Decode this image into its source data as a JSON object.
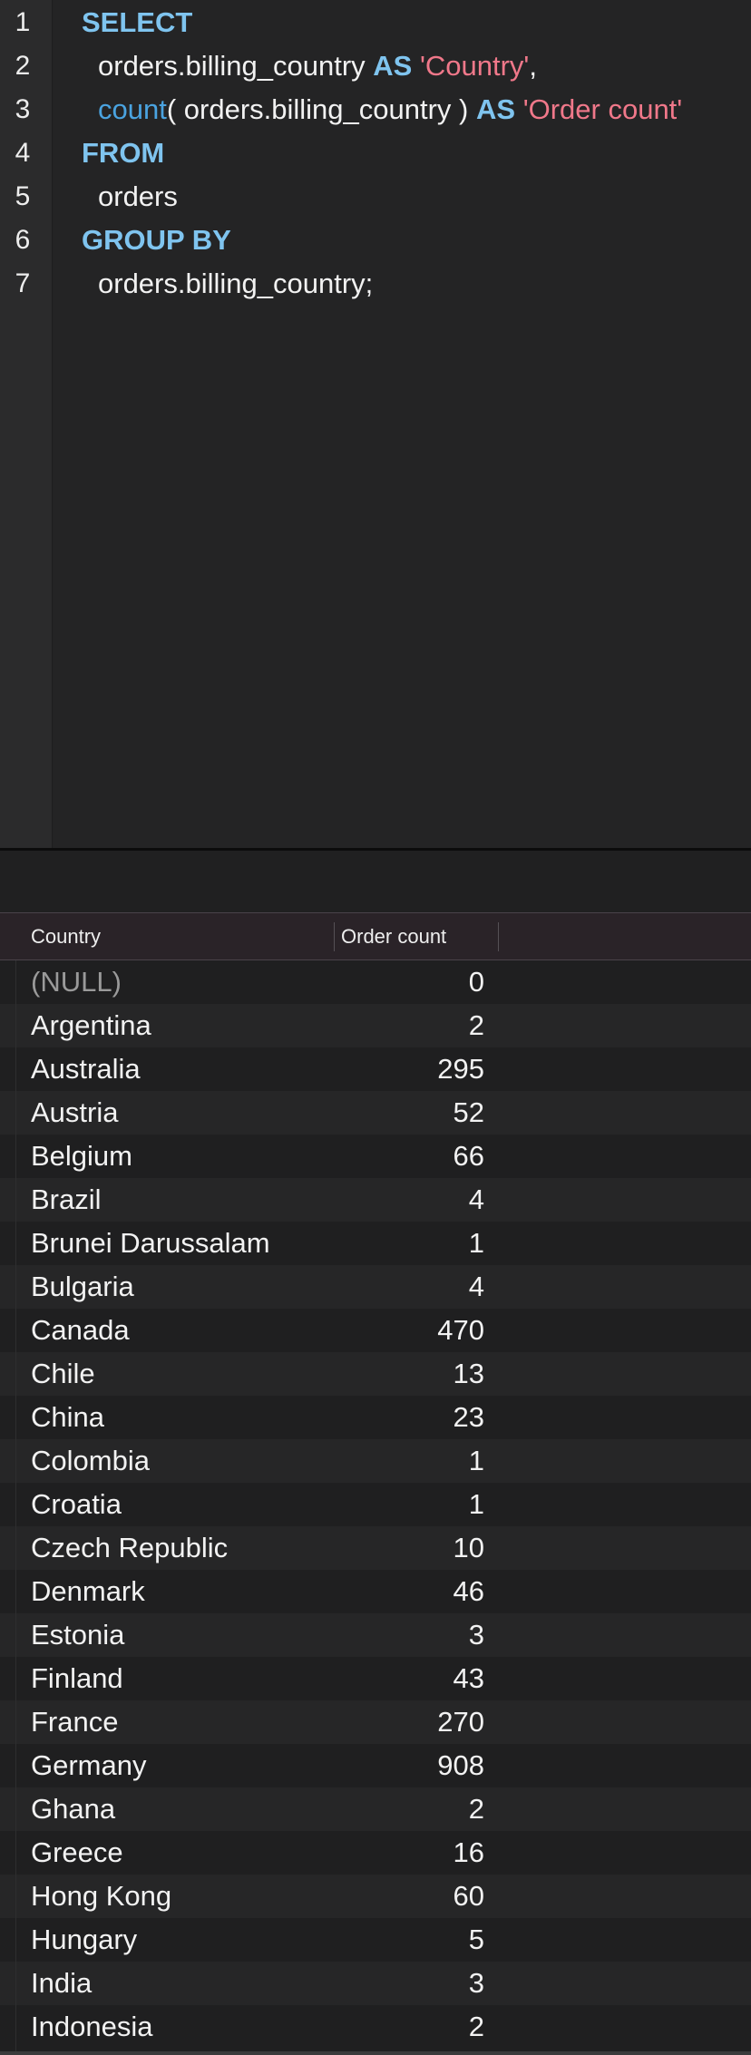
{
  "editor": {
    "lines": [
      {
        "no": "1",
        "tokens": [
          {
            "t": "SELECT",
            "c": "kw"
          }
        ],
        "indent": 90
      },
      {
        "no": "2",
        "tokens": [
          {
            "t": "orders.billing_country ",
            "c": ""
          },
          {
            "t": "AS",
            "c": "kw"
          },
          {
            "t": " ",
            "c": ""
          },
          {
            "t": "'Country'",
            "c": "str"
          },
          {
            "t": ",",
            "c": ""
          }
        ],
        "indent": 108
      },
      {
        "no": "3",
        "tokens": [
          {
            "t": "count",
            "c": "fn"
          },
          {
            "t": "( orders.billing_country ) ",
            "c": ""
          },
          {
            "t": "AS",
            "c": "kw"
          },
          {
            "t": " ",
            "c": ""
          },
          {
            "t": "'Order count'",
            "c": "str"
          }
        ],
        "indent": 108
      },
      {
        "no": "4",
        "tokens": [
          {
            "t": "FROM",
            "c": "kw"
          }
        ],
        "indent": 90
      },
      {
        "no": "5",
        "tokens": [
          {
            "t": "orders",
            "c": ""
          }
        ],
        "indent": 108
      },
      {
        "no": "6",
        "tokens": [
          {
            "t": "GROUP BY",
            "c": "kw"
          }
        ],
        "indent": 90
      },
      {
        "no": "7",
        "tokens": [
          {
            "t": "orders.billing_country;",
            "c": ""
          }
        ],
        "indent": 108
      }
    ]
  },
  "results": {
    "columns": [
      "Country",
      "Order count"
    ],
    "rows": [
      [
        "(NULL)",
        "0"
      ],
      [
        "Argentina",
        "2"
      ],
      [
        "Australia",
        "295"
      ],
      [
        "Austria",
        "52"
      ],
      [
        "Belgium",
        "66"
      ],
      [
        "Brazil",
        "4"
      ],
      [
        "Brunei Darussalam",
        "1"
      ],
      [
        "Bulgaria",
        "4"
      ],
      [
        "Canada",
        "470"
      ],
      [
        "Chile",
        "13"
      ],
      [
        "China",
        "23"
      ],
      [
        "Colombia",
        "1"
      ],
      [
        "Croatia",
        "1"
      ],
      [
        "Czech Republic",
        "10"
      ],
      [
        "Denmark",
        "46"
      ],
      [
        "Estonia",
        "3"
      ],
      [
        "Finland",
        "43"
      ],
      [
        "France",
        "270"
      ],
      [
        "Germany",
        "908"
      ],
      [
        "Ghana",
        "2"
      ],
      [
        "Greece",
        "16"
      ],
      [
        "Hong Kong",
        "60"
      ],
      [
        "Hungary",
        "5"
      ],
      [
        "India",
        "3"
      ],
      [
        "Indonesia",
        "2"
      ]
    ]
  }
}
